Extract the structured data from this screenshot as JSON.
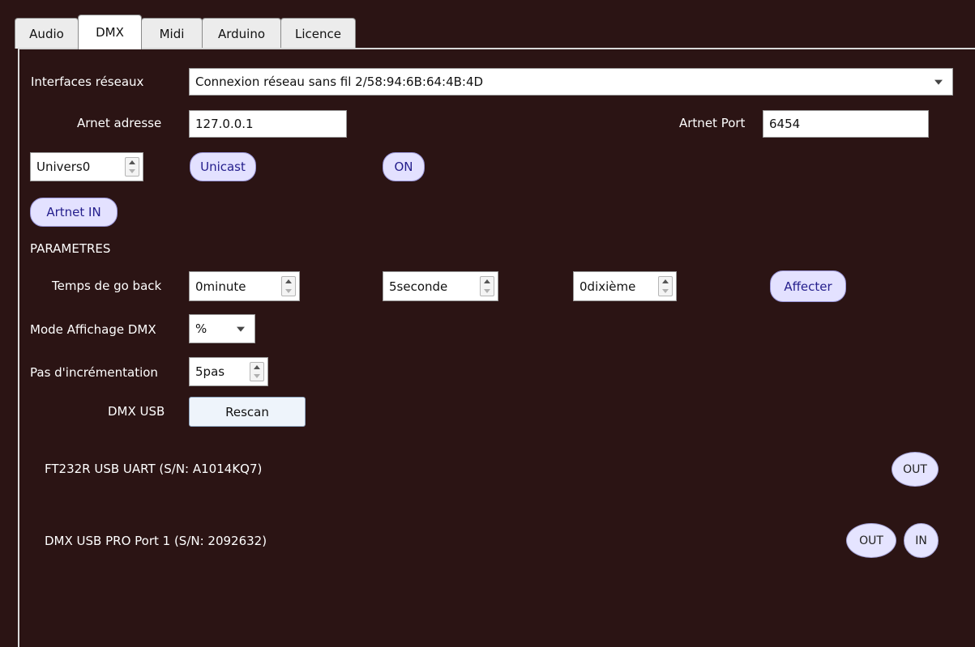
{
  "tabs": [
    "Audio",
    "DMX",
    "Midi",
    "Arduino",
    "Licence"
  ],
  "active_tab": "DMX",
  "network": {
    "interfaces_label": "Interfaces réseaux",
    "interface_value": "Connexion réseau sans fil 2/58:94:6B:64:4B:4D",
    "address_label": "Arnet adresse",
    "address_value": "127.0.0.1",
    "port_label": "Artnet Port",
    "port_value": "6454"
  },
  "universe": {
    "value": "Univers0",
    "unicast_label": "Unicast",
    "on_label": "ON",
    "artnet_in_label": "Artnet IN"
  },
  "params": {
    "section_label": "PARAMETRES",
    "goback_label": "Temps de go back",
    "minutes_value": "0minute",
    "seconds_value": "5seconde",
    "tenths_value": "0dixième",
    "apply_label": "Affecter",
    "display_mode_label": "Mode Affichage DMX",
    "display_mode_value": "%",
    "increment_label": "Pas d'incrémentation",
    "increment_value": "5pas",
    "dmx_usb_label": "DMX USB",
    "rescan_label": "Rescan"
  },
  "devices": [
    {
      "name": "FT232R USB UART (S/N: A1014KQ7)",
      "buttons": [
        "OUT"
      ]
    },
    {
      "name": "DMX USB PRO Port 1 (S/N: 2092632)",
      "buttons": [
        "OUT",
        "IN"
      ]
    }
  ]
}
